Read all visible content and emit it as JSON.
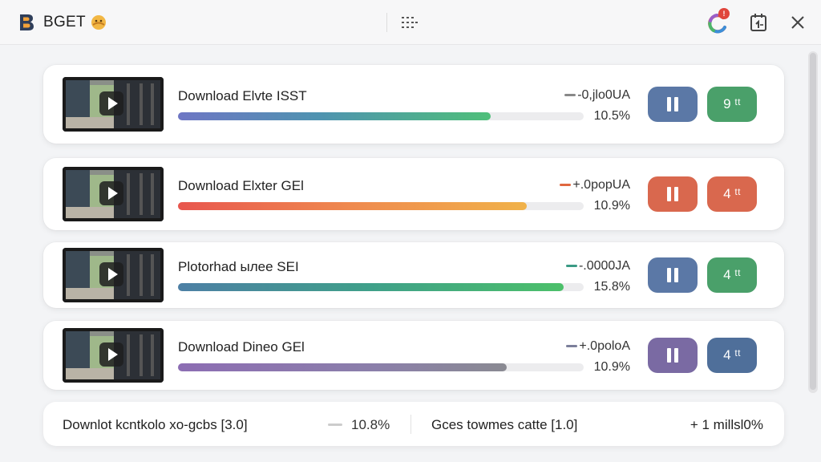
{
  "app": {
    "title": "BGET",
    "sync_badge": "!"
  },
  "colors": {
    "blue_button": "#5b78a6",
    "green_button": "#4aa06a",
    "orange_button": "#d9684e",
    "purple_button": "#7a6aa3"
  },
  "downloads": [
    {
      "title": "Download Elvte ISST",
      "speed": "-0,jlo0UA",
      "percent": "10.5%",
      "progress": 0.77,
      "alt_label": "9 ᵗᵗ",
      "fill": "linear-gradient(90deg,#6e76c4 0%,#4f93b0 45%,#4fbf7a 100%)",
      "dash_color": "#888",
      "pause_color": "#5b78a6",
      "alt_color": "#4aa06a"
    },
    {
      "title": "Download Elxter GEl",
      "speed": "+.0popUA",
      "percent": "10.9%",
      "progress": 0.86,
      "alt_label": "4 ᵗᵗ",
      "fill": "linear-gradient(90deg,#e8564e 0%,#ef8a4e 50%,#f0b24a 100%)",
      "dash_color": "#e0673f",
      "pause_color": "#d9684e",
      "alt_color": "#d9684e"
    },
    {
      "title": "Plotorhad ылее SEI",
      "speed": "-.0000JA",
      "percent": "15.8%",
      "progress": 0.95,
      "alt_label": "4 ᵗᵗ",
      "fill": "linear-gradient(90deg,#4d7fa5 0%,#3fa089 50%,#4cc06a 100%)",
      "dash_color": "#3a9a84",
      "pause_color": "#5b78a6",
      "alt_color": "#4aa06a"
    },
    {
      "title": "Download Dineo GEl",
      "speed": "+.0poloA",
      "percent": "10.9%",
      "progress": 0.81,
      "alt_label": "4 ᵗᵗ",
      "fill": "linear-gradient(90deg,#8c6db3 0%,#8b7faa 60%,#8a8a92 100%)",
      "dash_color": "#7b7f9a",
      "pause_color": "#7a6aa3",
      "alt_color": "#4f6f9a"
    }
  ],
  "footer": {
    "left": "Downlot kcntkolo xo-gcbs [3.0]",
    "percent": "10.8%",
    "middle": "Gces towmes catte [1.0]",
    "right": "+ 1 millsl0%"
  }
}
